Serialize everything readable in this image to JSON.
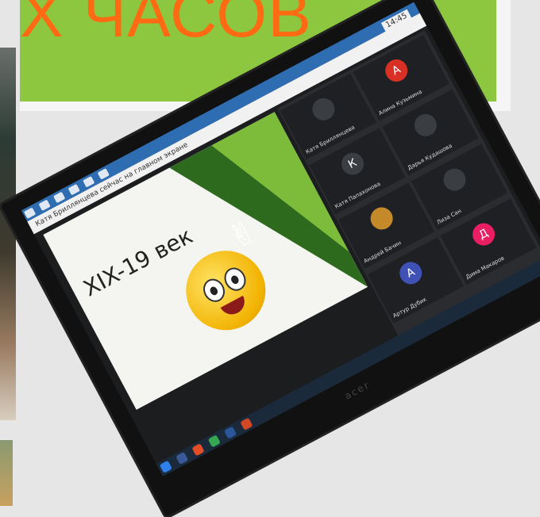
{
  "banner": {
    "text": "Х ЧАСОВ"
  },
  "browser": {
    "address": "Катя Бриллянцева сейчас на главном экране",
    "clock": "14:45"
  },
  "slide": {
    "title": "XIX-19 век"
  },
  "participants": [
    {
      "initial": "",
      "name": "Катя Бриллянцева",
      "color": "#3a3d42"
    },
    {
      "initial": "А",
      "name": "Алина Кузьмина",
      "color": "#d93025"
    },
    {
      "initial": "К",
      "name": "Катя Папахонова",
      "color": "#3a3d42"
    },
    {
      "initial": "",
      "name": "Дарья Кудашова",
      "color": "#3a3d42"
    },
    {
      "initial": "",
      "name": "Андрей Бачин",
      "color": "#c48a2a"
    },
    {
      "initial": "",
      "name": "Лиза Сан",
      "color": "#3a3d42"
    },
    {
      "initial": "А",
      "name": "Артур Дубик",
      "color": "#3f51b5"
    },
    {
      "initial": "Д",
      "name": "Дима Макаров",
      "color": "#e91e63"
    }
  ],
  "device": {
    "brand": "acer"
  },
  "colors": {
    "banner_bg": "#8dc63f",
    "banner_text": "#ff6a13"
  }
}
